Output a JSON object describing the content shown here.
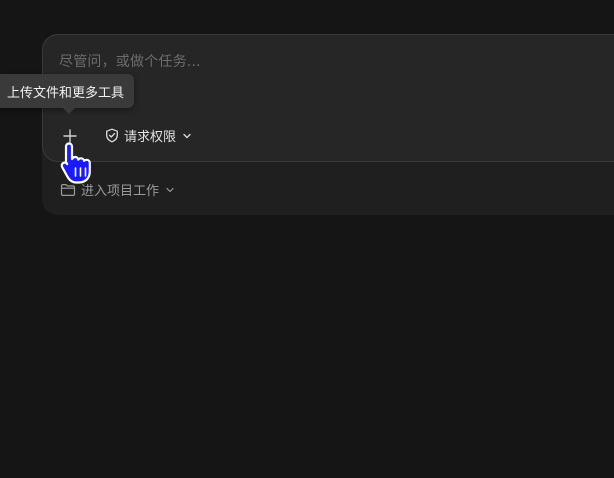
{
  "composer": {
    "placeholder": "尽管问，或做个任务..."
  },
  "toolbar": {
    "add_tooltip": "上传文件和更多工具",
    "permission_label": "请求权限"
  },
  "project": {
    "label": "进入项目工作"
  },
  "icons": {
    "add": "plus-icon",
    "permission": "shield-check-icon",
    "permission_menu": "chevron-down-icon",
    "project": "folder-icon",
    "project_menu": "chevron-down-icon",
    "pointer": "hand-pointer-icon"
  },
  "colors": {
    "background": "#151515",
    "composer": "#262626",
    "tooltip": "#3a3a3a",
    "cursor": "#1a1aff"
  }
}
